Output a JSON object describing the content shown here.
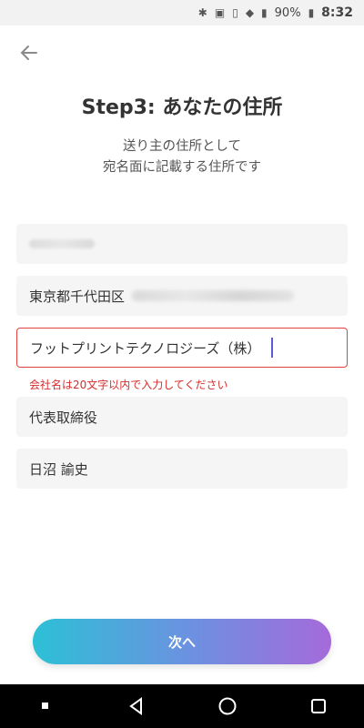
{
  "status": {
    "battery": "90%",
    "time": "8:32"
  },
  "header": {
    "title": "Step3: あなたの住所"
  },
  "subtitle": {
    "line1": "送り主の住所として",
    "line2": "宛名面に記載する住所です"
  },
  "form": {
    "postal_code": "",
    "address_prefix": "東京都千代田区",
    "company_name": "フットプリントテクノロジーズ（株）",
    "company_error": "会社名は20文字以内で入力してください",
    "title_value": "代表取締役",
    "person_name": "日沼 諭史"
  },
  "actions": {
    "next_label": "次へ"
  },
  "colors": {
    "error": "#d62c2c",
    "accent_start": "#2cc0d6",
    "accent_end": "#a56ad9"
  },
  "icons": [
    "back-arrow-icon",
    "bluetooth-icon",
    "nfc-icon",
    "vibrate-icon",
    "wifi-icon",
    "signal-icon",
    "battery-icon"
  ]
}
